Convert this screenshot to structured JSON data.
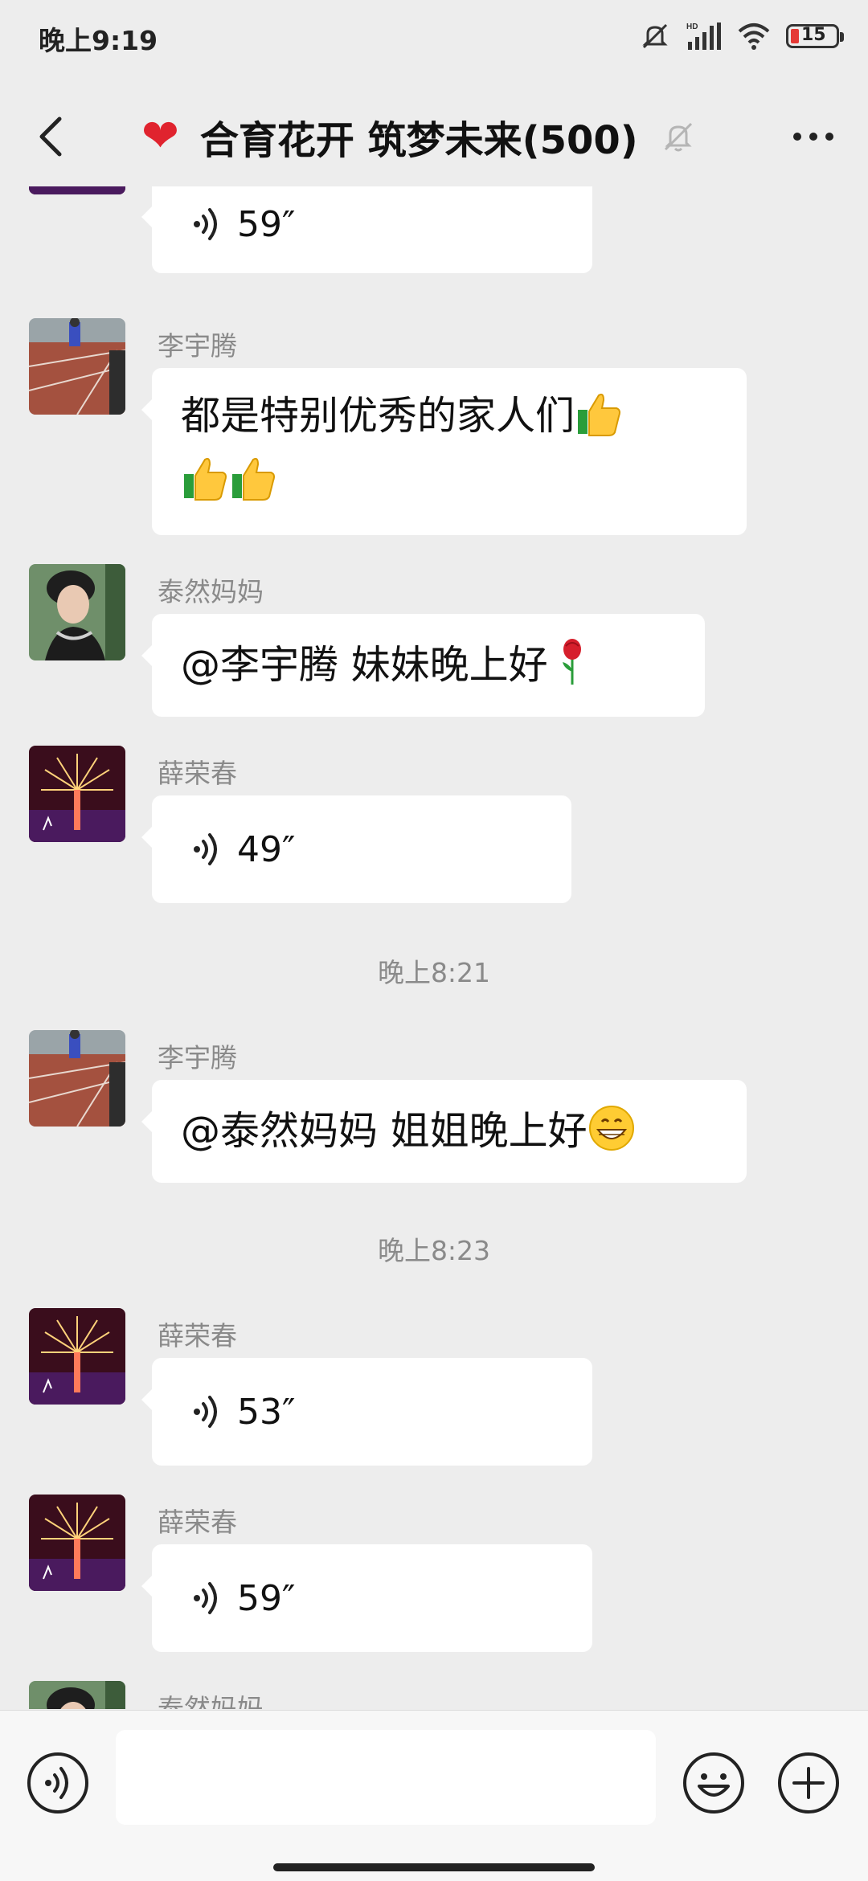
{
  "status_bar": {
    "time": "晚上9:19",
    "battery_level": "15",
    "network": "HD"
  },
  "header": {
    "title_icon": "red-heart",
    "title": "合育花开 筑梦未来(500)",
    "muted_icon": "bell-off-icon",
    "more_icon": "more-dots-icon",
    "back_icon": "back-chevron-icon"
  },
  "messages": [
    {
      "type": "voice",
      "sender": "",
      "duration": "59″",
      "avatar": "fireworks-avatar"
    },
    {
      "type": "text",
      "sender": "李宇腾",
      "text_line1": "都是特别优秀的家人们",
      "text_line2": "",
      "emojis": [
        "thumbs-up",
        "thumbs-up",
        "thumbs-up"
      ],
      "avatar": "track-runner-avatar"
    },
    {
      "type": "text",
      "sender": "泰然妈妈",
      "text": "@李宇腾  妹妹晚上好",
      "emojis": [
        "rose"
      ],
      "avatar": "woman-portrait-avatar"
    },
    {
      "type": "voice",
      "sender": "薛荣春",
      "duration": "49″",
      "avatar": "fireworks-avatar"
    },
    {
      "type": "time",
      "text": "晚上8:21"
    },
    {
      "type": "text",
      "sender": "李宇腾",
      "text": "@泰然妈妈  姐姐晚上好",
      "emojis": [
        "grinning-face"
      ],
      "avatar": "track-runner-avatar"
    },
    {
      "type": "time",
      "text": "晚上8:23"
    },
    {
      "type": "voice",
      "sender": "薛荣春",
      "duration": "53″",
      "avatar": "fireworks-avatar"
    },
    {
      "type": "voice",
      "sender": "薛荣春",
      "duration": "59″",
      "avatar": "fireworks-avatar"
    },
    {
      "type": "text",
      "sender": "泰然妈妈",
      "text": "",
      "avatar": "woman-portrait-avatar"
    }
  ],
  "input_bar": {
    "voice_icon": "voice-mode-icon",
    "placeholder": "",
    "emoji_icon": "emoji-icon",
    "plus_icon": "plus-icon"
  },
  "colors": {
    "background": "#ededed",
    "bubble": "#ffffff",
    "sender": "#8a8a8a",
    "heart": "#e0232e"
  }
}
